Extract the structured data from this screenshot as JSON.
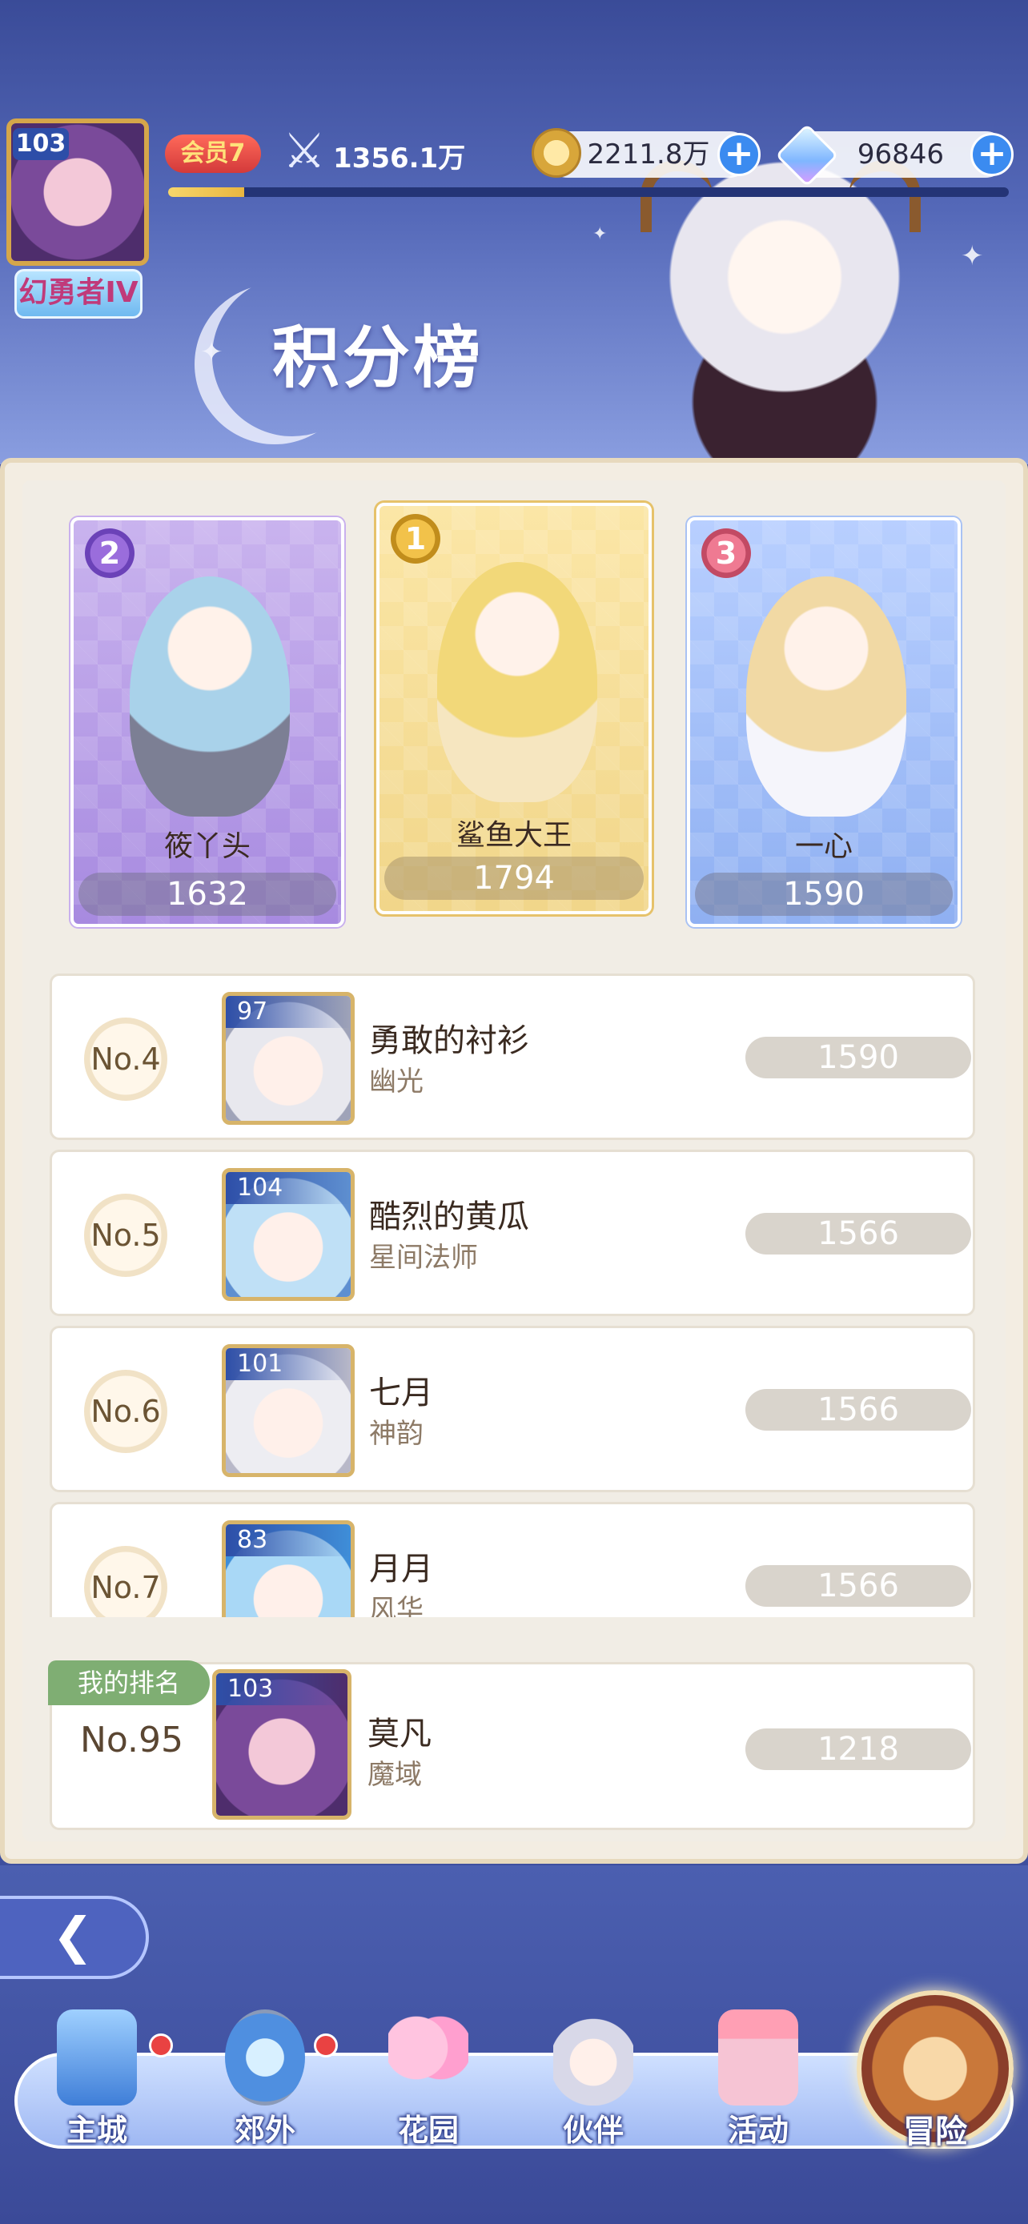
{
  "header": {
    "title": "积分榜",
    "player_level": "103",
    "player_title": "幻勇者IV",
    "vip_label": "会员7",
    "power": "1356.1万",
    "exp_progress": 0.09,
    "gold": "2211.8万",
    "gems": "96846"
  },
  "podium": [
    {
      "rank": "2",
      "name": "筱丫头",
      "score": "1632"
    },
    {
      "rank": "1",
      "name": "鲨鱼大王",
      "score": "1794"
    },
    {
      "rank": "3",
      "name": "一心",
      "score": "1590"
    }
  ],
  "list": [
    {
      "rank": "No.4",
      "level": "97",
      "name": "勇敢的衬衫",
      "server": "幽光",
      "score": "1590"
    },
    {
      "rank": "No.5",
      "level": "104",
      "name": "酷烈的黄瓜",
      "server": "星间法师",
      "score": "1566"
    },
    {
      "rank": "No.6",
      "level": "101",
      "name": "七月",
      "server": "神韵",
      "score": "1566"
    },
    {
      "rank": "No.7",
      "level": "83",
      "name": "月月",
      "server": "风华",
      "score": "1566"
    }
  ],
  "my_rank": {
    "tag": "我的排名",
    "rank": "No.95",
    "level": "103",
    "name": "莫凡",
    "server": "魔域",
    "score": "1218"
  },
  "nav": [
    {
      "label": "主城",
      "icon": "castle-icon",
      "badge": true
    },
    {
      "label": "郊外",
      "icon": "portal-icon",
      "badge": true
    },
    {
      "label": "花园",
      "icon": "heart-icon",
      "badge": false
    },
    {
      "label": "伙伴",
      "icon": "partner-icon",
      "badge": false
    },
    {
      "label": "活动",
      "icon": "gift-icon",
      "badge": false
    },
    {
      "label": "冒险",
      "icon": "adventure-icon",
      "badge": false
    }
  ],
  "colors": {
    "banner": "#3a4b98",
    "panel": "#f3ede2",
    "gold": "#d5a64a",
    "score_pill": "#d9d4cc",
    "my_rank_tag": "#7fae73"
  }
}
